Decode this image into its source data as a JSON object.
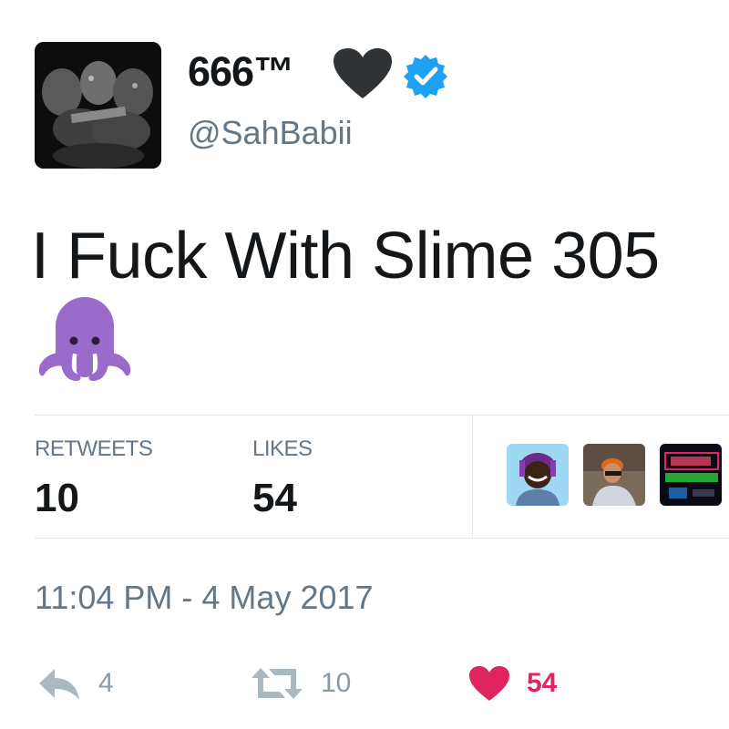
{
  "header": {
    "display_name": "666™",
    "handle": "@SahBabii"
  },
  "tweet": {
    "text": "I Fuck With Slime 305",
    "emoji": "octopus"
  },
  "stats": {
    "retweets_label": "RETWEETS",
    "retweets_count": "10",
    "likes_label": "LIKES",
    "likes_count": "54"
  },
  "timestamp": "11:04 PM - 4 May 2017",
  "actions": {
    "reply_count": "4",
    "retweet_count": "10",
    "like_count": "54"
  },
  "colors": {
    "text_primary": "#14171a",
    "text_secondary": "#657786",
    "verified_blue": "#1da1f2",
    "like_red": "#e0245e",
    "action_gray": "#aab8c2",
    "octopus_purple": "#9b6bcc",
    "divider": "#e1e8ed"
  },
  "icons": [
    "black-heart-icon",
    "verified-badge-icon",
    "octopus-emoji",
    "reply-icon",
    "retweet-icon",
    "like-heart-icon"
  ]
}
